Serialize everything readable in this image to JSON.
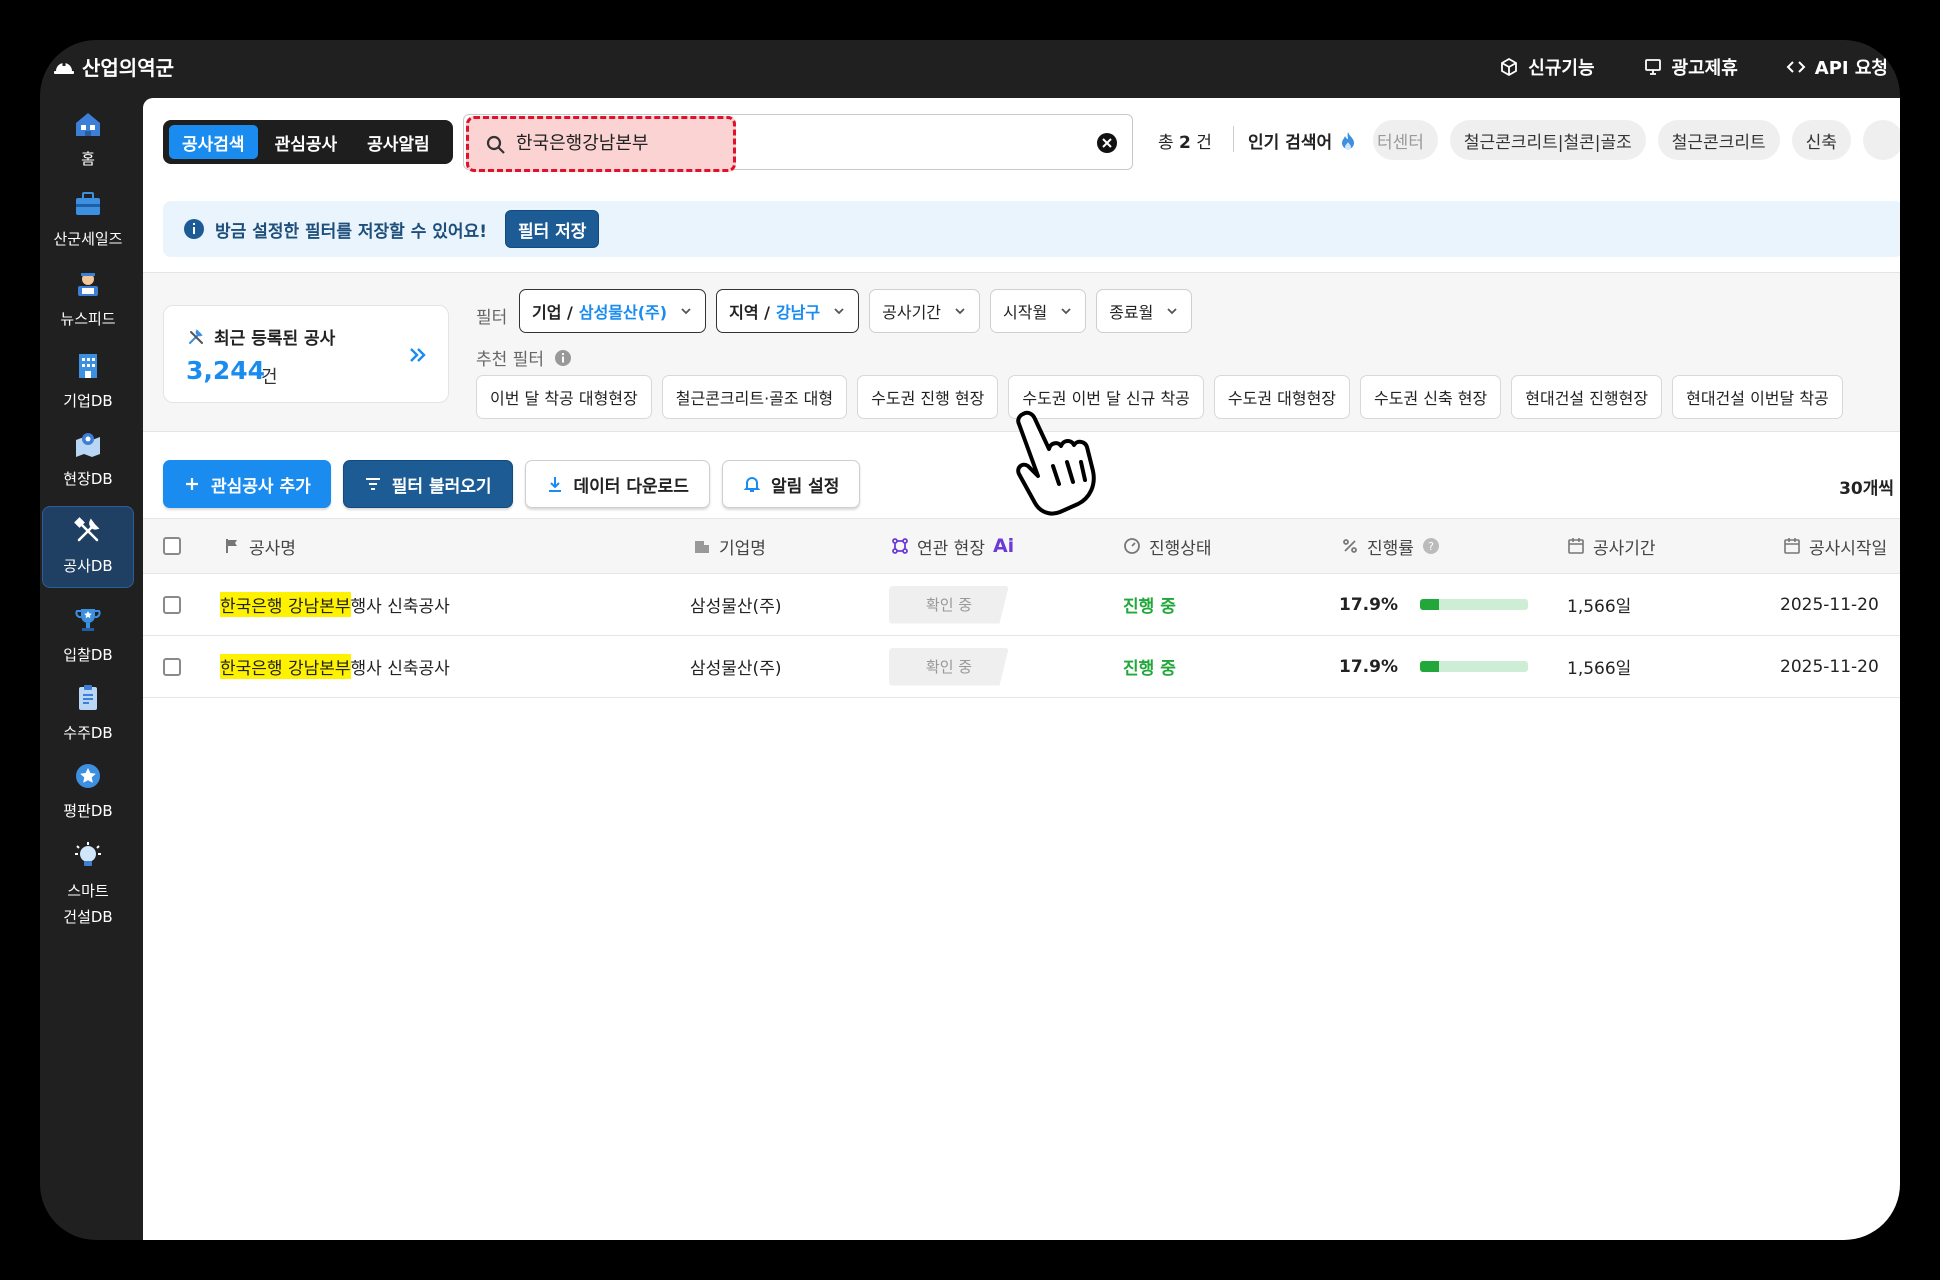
{
  "app": {
    "logo_text": "산업의역군"
  },
  "topnav": [
    {
      "label": "신규기능",
      "icon": "cube-icon"
    },
    {
      "label": "광고제휴",
      "icon": "monitor-icon"
    },
    {
      "label": "API 요청",
      "icon": "code-icon"
    }
  ],
  "sidebar": {
    "items": [
      {
        "label": "홈",
        "icon": "home-icon"
      },
      {
        "label": "산군세일즈",
        "icon": "briefcase-icon"
      },
      {
        "label": "뉴스피드",
        "icon": "newsboy-icon"
      },
      {
        "label": "기업DB",
        "icon": "building-icon"
      },
      {
        "label": "현장DB",
        "icon": "site-map-icon"
      },
      {
        "label": "공사DB",
        "icon": "tools-icon"
      },
      {
        "label": "입찰DB",
        "icon": "trophy-icon"
      },
      {
        "label": "수주DB",
        "icon": "clipboard-icon"
      },
      {
        "label": "평판DB",
        "icon": "star-badge-icon"
      },
      {
        "label_line1": "스마트",
        "label_line2": "건설DB",
        "icon": "lightbulb-icon"
      }
    ],
    "active_index": 5
  },
  "tabs": [
    "공사검색",
    "관심공사",
    "공사알림"
  ],
  "search": {
    "value": "한국은행강남본부"
  },
  "results": {
    "prefix": "총",
    "count": "2",
    "unit": "건"
  },
  "popular": {
    "label": "인기 검색어",
    "chips": [
      "터센터",
      "철근콘크리트|철콘|골조",
      "철근콘크리트",
      "신축"
    ]
  },
  "banner": {
    "text": "방금 설정한 필터를 저장할 수 있어요!",
    "button": "필터 저장"
  },
  "recent": {
    "title": "최근 등록된 공사",
    "count": "3,244",
    "unit": "건"
  },
  "filters": {
    "label": "필터",
    "items": [
      {
        "key": "기업 /",
        "value": "삼성물산(주)",
        "selected": true
      },
      {
        "key": "지역 /",
        "value": "강남구",
        "selected": true
      },
      {
        "key": "공사기간",
        "value": ""
      },
      {
        "key": "시작월",
        "value": ""
      },
      {
        "key": "종료월",
        "value": ""
      }
    ]
  },
  "recommended": {
    "label": "추천 필터",
    "chips": [
      "이번 달 착공 대형현장",
      "철근콘크리트·골조 대형",
      "수도권 진행 현장",
      "수도권 이번 달 신규 착공",
      "수도권 대형현장",
      "수도권 신축 현장",
      "현대건설 진행현장",
      "현대건설 이번달 착공"
    ]
  },
  "actions": {
    "add_interest": "관심공사 추가",
    "load_filter": "필터 불러오기",
    "download": "데이터 다운로드",
    "alert": "알림 설정",
    "per_page": "30개씩"
  },
  "table": {
    "headers": {
      "name": "공사명",
      "company": "기업명",
      "related": "연관 현장",
      "related_tag": "Ai",
      "status": "진행상태",
      "progress": "진행률",
      "period": "공사기간",
      "start": "공사시작일"
    },
    "rows": [
      {
        "name_hl": "한국은행 강남본부",
        "name_rest": "행사 신축공사",
        "company": "삼성물산(주)",
        "related": "확인 중",
        "status": "진행 중",
        "progress": "17.9%",
        "progress_value": 17.9,
        "period": "1,566일",
        "start": "2025-11-20"
      },
      {
        "name_hl": "한국은행 강남본부",
        "name_rest": "행사 신축공사",
        "company": "삼성물산(주)",
        "related": "확인 중",
        "status": "진행 중",
        "progress": "17.9%",
        "progress_value": 17.9,
        "period": "1,566일",
        "start": "2025-11-20"
      }
    ]
  },
  "colors": {
    "accent": "#1a8cf0",
    "dark_blue": "#1d5b95",
    "success": "#22a83a",
    "ai": "#6c3bd6",
    "highlight": "#fff200",
    "search_highlight": "#e0112b"
  }
}
